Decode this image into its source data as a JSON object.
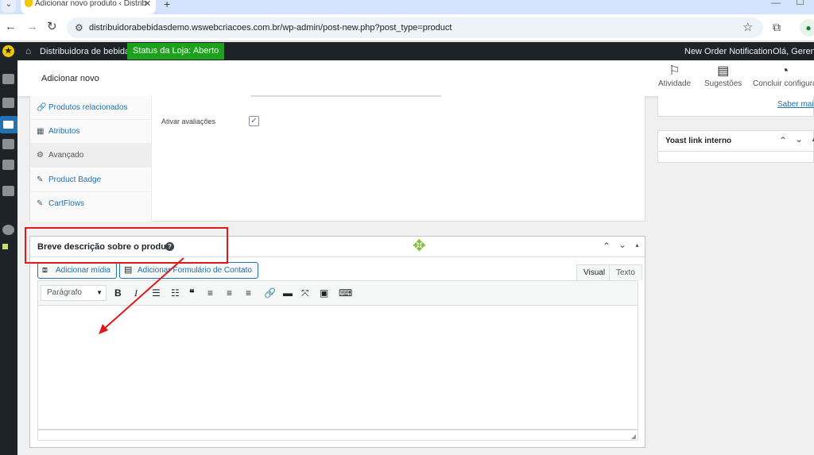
{
  "browser": {
    "tab_title": "Adicionar novo produto ‹ Distrib",
    "url": "distribuidorabebidasdemo.wswebcriacoes.com.br/wp-admin/post-new.php?post_type=product"
  },
  "adminbar": {
    "site_name": "Distribuidora de bebidas",
    "store_status": "Status da Loja: Aberto",
    "order_notification": "New Order Notification",
    "greeting": "Olá, Gerente"
  },
  "header": {
    "page_title": "Adicionar novo",
    "actions": [
      {
        "label": "Atividade",
        "icon": "flag-icon"
      },
      {
        "label": "Sugestões",
        "icon": "comment-icon"
      },
      {
        "label": "Concluir configura",
        "icon": "progress-icon"
      }
    ]
  },
  "product_data": {
    "tabs": [
      {
        "label": "Produtos relacionados",
        "icon": "link-icon"
      },
      {
        "label": "Atributos",
        "icon": "list-icon"
      },
      {
        "label": "Avançado",
        "icon": "gear-icon",
        "active": true
      },
      {
        "label": "Product Badge",
        "icon": "wrench-icon"
      },
      {
        "label": "CartFlows",
        "icon": "wrench-icon"
      }
    ],
    "enable_reviews_label": "Ativar avaliações",
    "enable_reviews_checked": true
  },
  "short_description": {
    "title": "Breve descrição sobre o produto",
    "add_media": "Adicionar mídia",
    "add_contact_form": "Adicionar Formulário de Contato",
    "tab_visual": "Visual",
    "tab_text": "Texto",
    "format_select": "Parágrafo"
  },
  "sidebar": {
    "learn_more": "Saber mais",
    "yoast_title": "Yoast link interno"
  },
  "colors": {
    "admin_bar": "#1d2327",
    "status_green": "#1ca11c",
    "link_blue": "#2271b1",
    "annotation_red": "#e01919",
    "move_icon_green": "#7cbf2f"
  }
}
